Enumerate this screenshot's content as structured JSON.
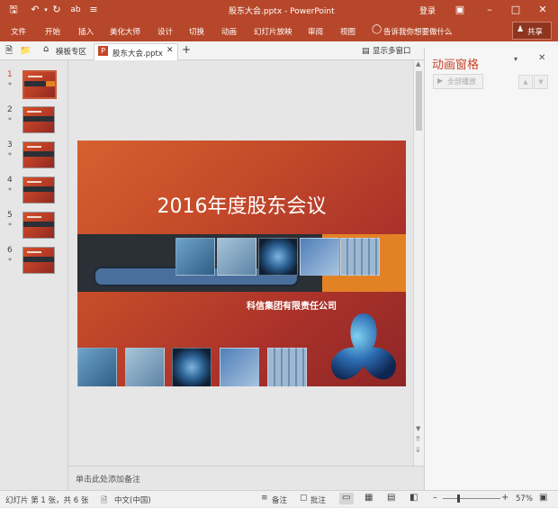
{
  "titlebar": {
    "title": "股东大会.pptx  -  PowerPoint",
    "login": "登录",
    "icons": [
      "save-icon",
      "undo-icon",
      "redo-icon",
      "spell-icon",
      "customize-icon",
      "ribbon-display-icon",
      "minimize-icon",
      "restore-icon",
      "close-icon"
    ]
  },
  "ribbon": {
    "tabs": [
      "文件",
      "开始",
      "插入",
      "美化大师",
      "设计",
      "切换",
      "动画",
      "幻灯片放映",
      "审阅",
      "视图"
    ],
    "tell_me": "告诉我你想要做什么",
    "share": "共享"
  },
  "doc_tabs": {
    "template_tab": "模板专区",
    "file_tab": "股东大会.pptx",
    "multi_window": "显示多窗口"
  },
  "thumbnails": [
    {
      "num": "1",
      "star": "*"
    },
    {
      "num": "2",
      "star": "*"
    },
    {
      "num": "3",
      "star": "*"
    },
    {
      "num": "4",
      "star": "*"
    },
    {
      "num": "5",
      "star": "*"
    },
    {
      "num": "6",
      "star": "*"
    }
  ],
  "slide": {
    "title": "2016年度股东会议",
    "company": "科信集团有限责任公司"
  },
  "notes": {
    "placeholder": "单击此处添加备注"
  },
  "animation_pane": {
    "title": "动画窗格",
    "play_all": "全部播放"
  },
  "status": {
    "slide_info": "幻灯片 第 1 张，共 6 张",
    "language": "中文(中国)",
    "notes_btn": "备注",
    "comments_btn": "批注",
    "zoom": "57%",
    "zoom_fraction": 0.57
  },
  "colors": {
    "accent": "#b7472a",
    "slide_orange": "#e38225",
    "slide_dark": "#2b2f36"
  }
}
